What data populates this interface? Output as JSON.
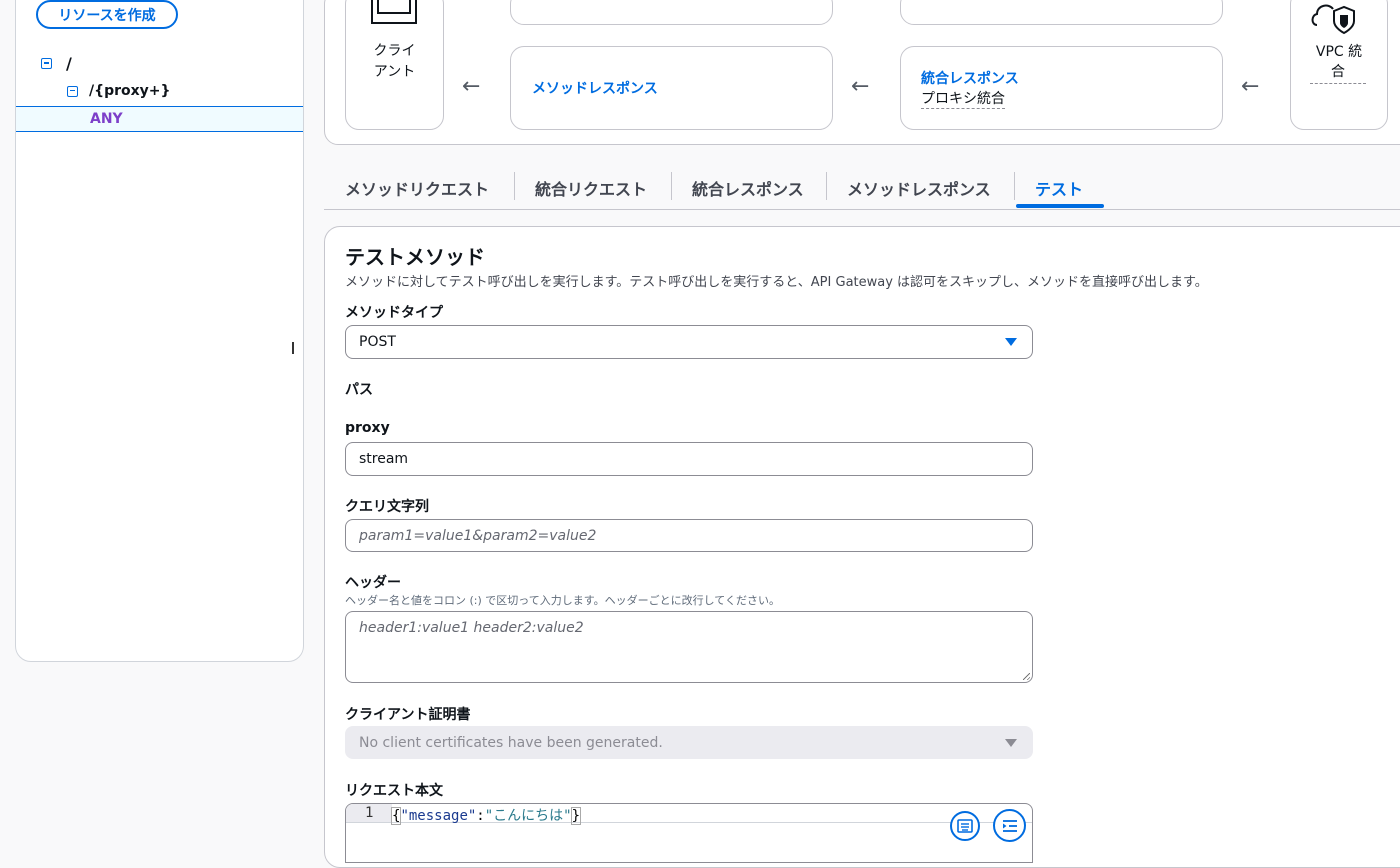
{
  "sidebar": {
    "create_button": "リソースを作成",
    "tree": [
      {
        "label": "/"
      },
      {
        "label": "/{proxy+}"
      },
      {
        "label": "ANY"
      }
    ]
  },
  "flow": {
    "client": [
      "クライ",
      "アント"
    ],
    "method_response": "メソッドレスポンス",
    "integration_response": "統合レスポンス",
    "integration_type": "プロキシ統合",
    "vpc": [
      "VPC 統",
      "合"
    ],
    "arrow": "←"
  },
  "tabs": [
    {
      "label": "メソッドリクエスト"
    },
    {
      "label": "統合リクエスト"
    },
    {
      "label": "統合レスポンス"
    },
    {
      "label": "メソッドレスポンス"
    },
    {
      "label": "テスト",
      "active": true
    }
  ],
  "test": {
    "title": "テストメソッド",
    "description": "メソッドに対してテスト呼び出しを実行します。テスト呼び出しを実行すると、API Gateway は認可をスキップし、メソッドを直接呼び出します。",
    "method_type_label": "メソッドタイプ",
    "method_type_value": "POST",
    "path_label": "パス",
    "proxy_label": "proxy",
    "proxy_value": "stream",
    "query_label": "クエリ文字列",
    "query_placeholder": "param1=value1&param2=value2",
    "headers_label": "ヘッダー",
    "headers_description": "ヘッダー名と値をコロン (:) で区切って入力します。ヘッダーごとに改行してください。",
    "headers_placeholder": "header1:value1 header2:value2",
    "client_cert_label": "クライアント証明書",
    "client_cert_value": "No client certificates have been generated.",
    "body_label": "リクエスト本文",
    "body_line_no": "1",
    "body_key": "\"message\"",
    "body_colon": ":",
    "body_value": "\"こんにちは\""
  },
  "colors": {
    "accent": "#006ce0",
    "method_badge": "#7d3fc9"
  }
}
